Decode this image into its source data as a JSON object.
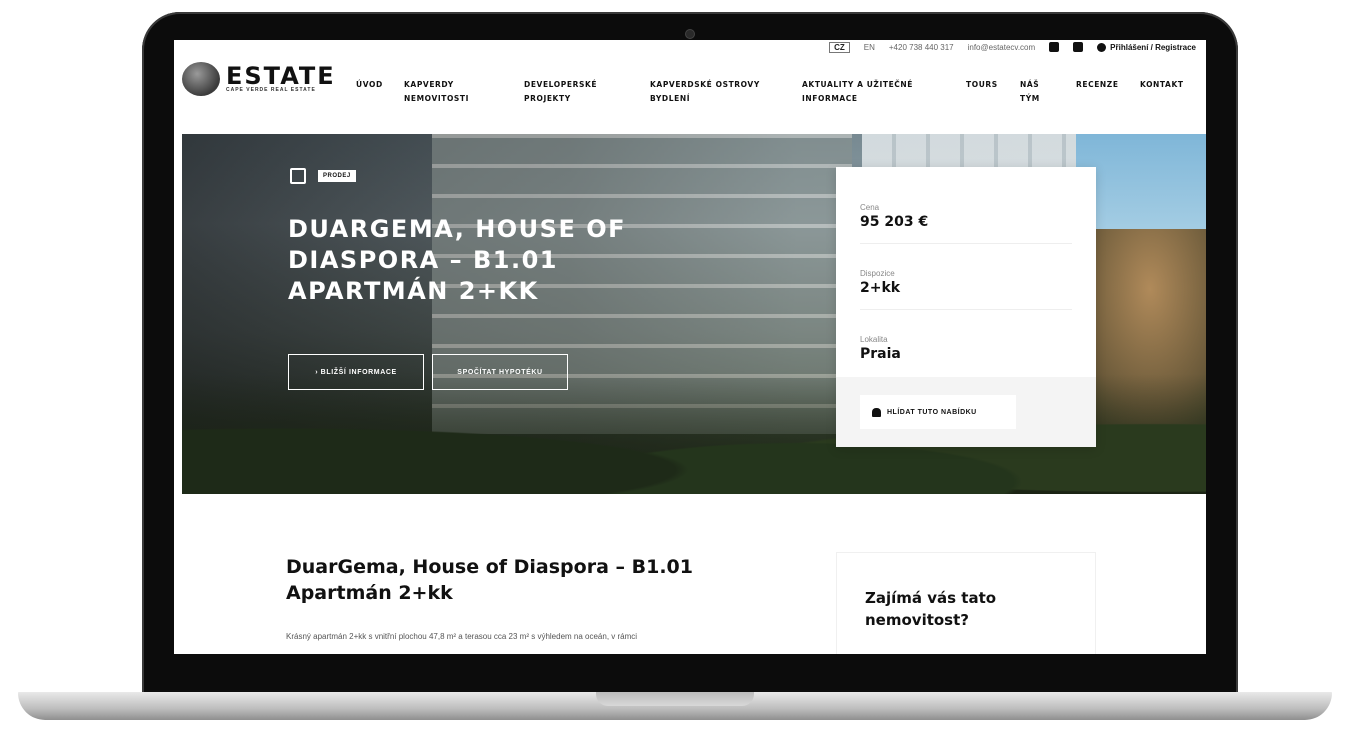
{
  "util": {
    "lang_active": "CZ",
    "lang_other": "EN",
    "phone": "+420 738 440 317",
    "email": "info@estatecv.com",
    "login": "Přihlášení / Registrace"
  },
  "logo": {
    "word": "ESTATE",
    "sub": "CAPE VERDE REAL ESTATE"
  },
  "nav": {
    "items": [
      {
        "l1": "ÚVOD",
        "l2": ""
      },
      {
        "l1": "KAPVERDY",
        "l2": "NEMOVITOSTI"
      },
      {
        "l1": "DEVELOPERSKÉ",
        "l2": "PROJEKTY"
      },
      {
        "l1": "KAPVERDSKÉ OSTROVY",
        "l2": "BYDLENÍ"
      },
      {
        "l1": "AKTUALITY A UŽITEČNÉ",
        "l2": "INFORMACE"
      },
      {
        "l1": "TOURS",
        "l2": ""
      },
      {
        "l1": "NÁŠ",
        "l2": "TÝM"
      },
      {
        "l1": "RECENZE",
        "l2": ""
      },
      {
        "l1": "KONTAKT",
        "l2": ""
      }
    ]
  },
  "hero": {
    "badge": "PRODEJ",
    "title": "DUARGEMA, HOUSE OF DIASPORA – B1.01 APARTMÁN 2+KK",
    "btn_info": "› BLIŽŠÍ INFORMACE",
    "btn_mortgage": "SPOČÍTAT HYPOTÉKU"
  },
  "card": {
    "price_label": "Cena",
    "price": "95 203 €",
    "layout_label": "Dispozice",
    "layout": "2+kk",
    "location_label": "Lokalita",
    "location": "Praia",
    "watch": "HLÍDAT TUTO NABÍDKU"
  },
  "content": {
    "title": "DuarGema, House of Diaspora – B1.01 Apartmán 2+kk",
    "text": "Krásný apartmán 2+kk s vnitřní plochou 47,8 m² a terasou cca 23 m² s výhledem na oceán, v rámci",
    "aside_title": "Zajímá vás tato nemovitost?"
  },
  "icons": {
    "building": "building-icon",
    "bell": "bell-icon",
    "facebook": "facebook-icon",
    "instagram": "instagram-icon",
    "user": "user-icon"
  }
}
